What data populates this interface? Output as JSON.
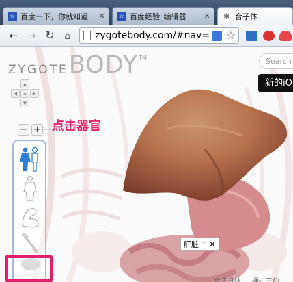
{
  "tabs": [
    {
      "title": "百度一下，你就知道",
      "icon": "baidu-paw-icon",
      "fav_glyph": "☆",
      "active": false
    },
    {
      "title": "百度经验_编辑器",
      "icon": "baidu-paw-icon",
      "fav_glyph": "☆",
      "active": false
    },
    {
      "title": "合子体",
      "icon": "loading-spinner-icon",
      "fav_glyph": "✱",
      "active": true
    }
  ],
  "tab_close_glyph": "✕",
  "toolbar": {
    "back_glyph": "←",
    "forward_glyph": "→",
    "reload_glyph": "↻",
    "home_glyph": "⌂",
    "url": "zygotebody.com/#nav=",
    "star_glyph": "☆"
  },
  "page": {
    "logo_zygote": "ZYGOTE",
    "logo_body": "BODY",
    "logo_tm": "TM",
    "search_placeholder": "Search",
    "promo_text": "新的iO",
    "zoom_minus": "−",
    "zoom_plus": "+",
    "annotation": "点击器官",
    "organ_label": "肝脏",
    "organ_pin_glyph": "†",
    "organ_close_glyph": "✕",
    "footer_text": "合子具体 ... 通过三伯"
  },
  "colors": {
    "annotation": "#e42a6c",
    "highlight_border": "#e0206a",
    "liver": "#b8724e",
    "layer_active": "#2f7fd1"
  }
}
